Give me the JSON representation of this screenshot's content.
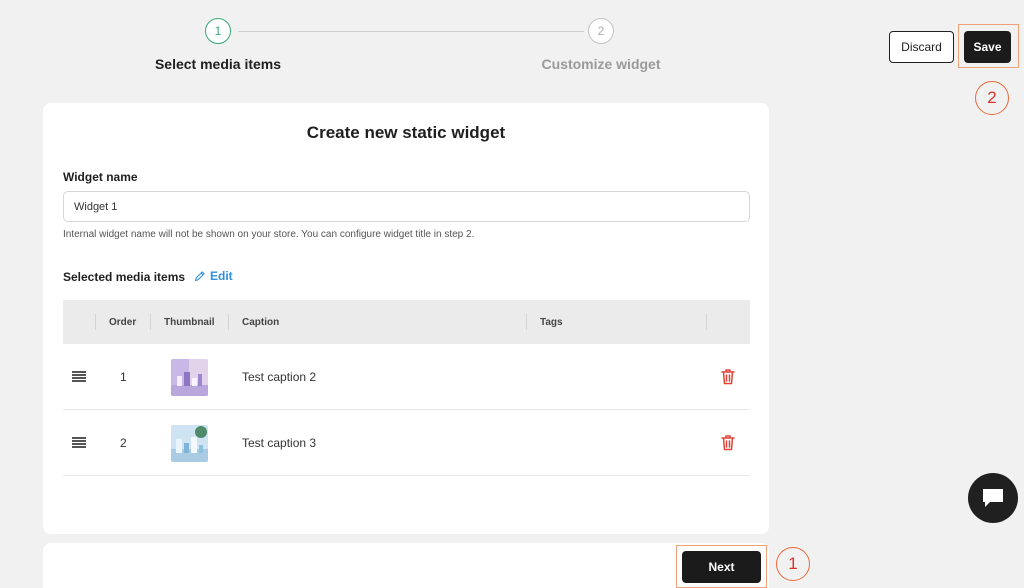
{
  "stepper": {
    "steps": [
      {
        "number": "1",
        "label": "Select media items",
        "state": "active"
      },
      {
        "number": "2",
        "label": "Customize widget",
        "state": "inactive"
      }
    ]
  },
  "actions": {
    "discard_label": "Discard",
    "save_label": "Save"
  },
  "markers": {
    "save_marker": "2",
    "next_marker": "1"
  },
  "form": {
    "title": "Create new static widget",
    "widget_name_label": "Widget name",
    "widget_name_value": "Widget 1",
    "helper_text": "Internal widget name will not be shown on your store. You can configure widget title in step 2.",
    "media_label": "Selected media items",
    "edit_label": "Edit"
  },
  "table": {
    "columns": [
      "Order",
      "Thumbnail",
      "Caption",
      "Tags"
    ],
    "rows": [
      {
        "order": "1",
        "caption": "Test caption 2",
        "tags": ""
      },
      {
        "order": "2",
        "caption": "Test caption 3",
        "tags": ""
      }
    ]
  },
  "footer": {
    "next_label": "Next"
  },
  "colors": {
    "accent_green": "#3aa874",
    "link_blue": "#2f8fe0",
    "danger_red": "#e0443a",
    "highlight_orange": "#f0a078"
  }
}
